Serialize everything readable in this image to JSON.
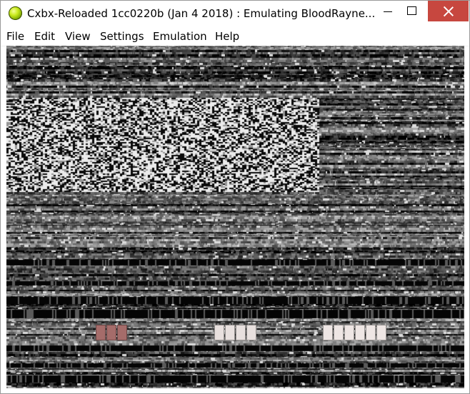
{
  "window": {
    "title": "Cxbx-Reloaded 1cc0220b (Jan  4 2018) : Emulating BloodRayne...",
    "app_icon": "cxbx-orb-icon",
    "controls": {
      "minimize": "minimize-icon",
      "maximize": "maximize-icon",
      "close": "close-icon"
    },
    "colors": {
      "close_hover": "#c7473f"
    }
  },
  "menu": {
    "items": [
      {
        "label": "File"
      },
      {
        "label": "Edit"
      },
      {
        "label": "View"
      },
      {
        "label": "Settings"
      },
      {
        "label": "Emulation"
      },
      {
        "label": "Help"
      }
    ]
  },
  "viewport": {
    "content": "garbled-emulation-framebuffer",
    "hud_groups": [
      {
        "cells": 3,
        "color": "#a56c6a"
      },
      {
        "cells": 4,
        "color": "#e8e0de"
      },
      {
        "cells": 6,
        "color": "#eee6e4"
      }
    ]
  }
}
